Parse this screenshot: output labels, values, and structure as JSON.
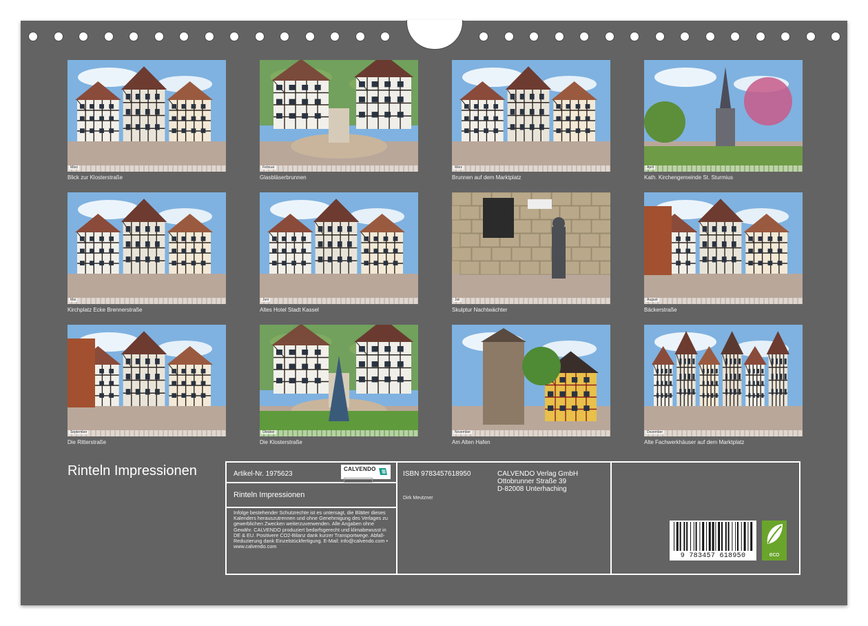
{
  "colors": {
    "background": "#636363",
    "panel_border": "#ffffff",
    "eco_green": "#6aa52b"
  },
  "tiles": [
    {
      "caption": "Blick zur Klosterstraße",
      "month": "März",
      "scene": "square"
    },
    {
      "caption": "Glasbläserbrunnen",
      "month": "Februar",
      "scene": "fountain"
    },
    {
      "caption": "Brunnen auf dem Marktplatz",
      "month": "März",
      "scene": "market"
    },
    {
      "caption": "Kath. Kirchengemeinde St. Sturmius",
      "month": "April",
      "scene": "church"
    },
    {
      "caption": "Kirchplatz Ecke Brennerstraße",
      "month": "Mai",
      "scene": "corner"
    },
    {
      "caption": "Altes Hotel Stadt Kassel",
      "month": "Juni",
      "scene": "hotel"
    },
    {
      "caption": "Skulptur Nachtwächter",
      "month": "Juli",
      "scene": "sculpture"
    },
    {
      "caption": "Bäckerstraße",
      "month": "August",
      "scene": "street"
    },
    {
      "caption": "Die Ritterstraße",
      "month": "September",
      "scene": "lane"
    },
    {
      "caption": "Die Klosterstraße",
      "month": "Oktober",
      "scene": "monastery"
    },
    {
      "caption": "Am Alten Hafen",
      "month": "November",
      "scene": "tower"
    },
    {
      "caption": "Alte Fachwerkhäuser auf dem Marktplatz",
      "month": "Dezember",
      "scene": "row"
    }
  ],
  "title": "Rinteln Impressionen",
  "info": {
    "article": "Artikel-Nr. 1975623",
    "brand": "CALVENDO",
    "brand_sub": "Dein Kalenderverlag",
    "series_title": "Rinteln Impressionen",
    "legal": "Infolge bestehender Schutzrechte ist es untersagt, die Blätter dieses Kalenders herauszutrennen und ohne Genehmigung des Verlages zu gewerblichen Zwecken weiterzuverwenden. Alle Angaben ohne Gewähr. CALVENDO produziert bedarfsgerecht und klimabewusst in DE & EU. Positivere CO2-Bilanz dank kurzer Transportwege. Abfall-Reduzierung dank Einzelstückfertigung. E-Mail: info@calvendo.com • www.calvendo.com",
    "isbn": "ISBN 9783457618950",
    "author": "Dirk Meutzner",
    "publisher_lines": [
      "CALVENDO Verlag GmbH",
      "Ottobrunner Straße 39",
      "D-82008 Unterhaching"
    ],
    "barcode_number": "9 783457 618950",
    "eco_label": "eco",
    "icons": {
      "brand_mark": "calvendo-flag-icon",
      "eco": "leaf-icon"
    }
  }
}
